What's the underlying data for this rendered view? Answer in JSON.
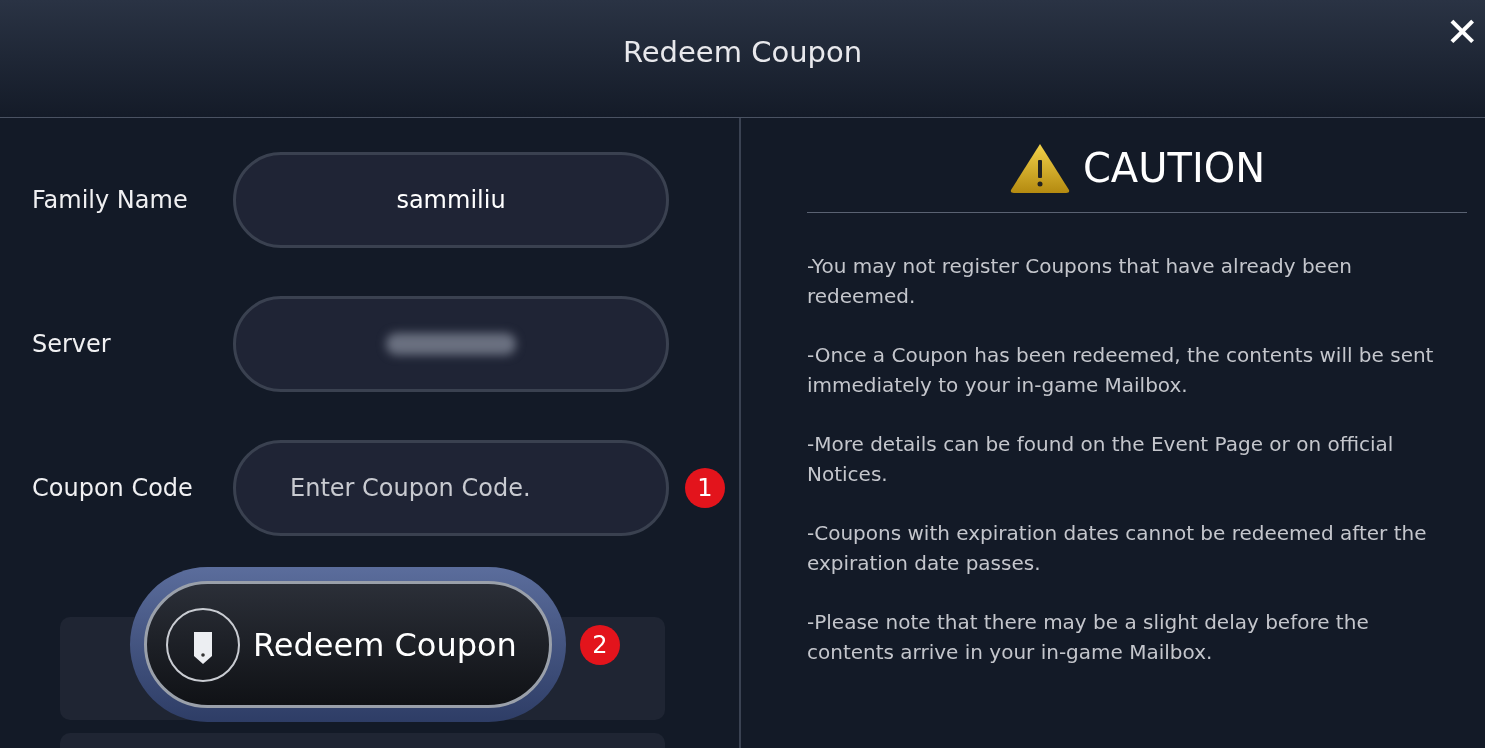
{
  "dialog": {
    "title": "Redeem Coupon",
    "close_label": "✕"
  },
  "form": {
    "fields": [
      {
        "label": "Family Name",
        "kind": "value",
        "value": "sammiliu"
      },
      {
        "label": "Server",
        "kind": "redacted"
      },
      {
        "label": "Coupon Code",
        "kind": "input",
        "placeholder": "Enter Coupon Code.",
        "marker": "1"
      }
    ],
    "submit": {
      "label": "Redeem Coupon",
      "marker": "2"
    }
  },
  "caution": {
    "title": "CAUTION",
    "notes": [
      "-You may not register Coupons that have already been redeemed.",
      "-Once a Coupon has been redeemed, the contents will be sent immediately to your in-game Mailbox.",
      "-More details can be found on the Event Page or on official Notices.",
      "-Coupons with expiration dates cannot be redeemed after the expiration date passes.",
      "-Please note that there may be a slight delay before the contents arrive in your in-game Mailbox."
    ]
  }
}
